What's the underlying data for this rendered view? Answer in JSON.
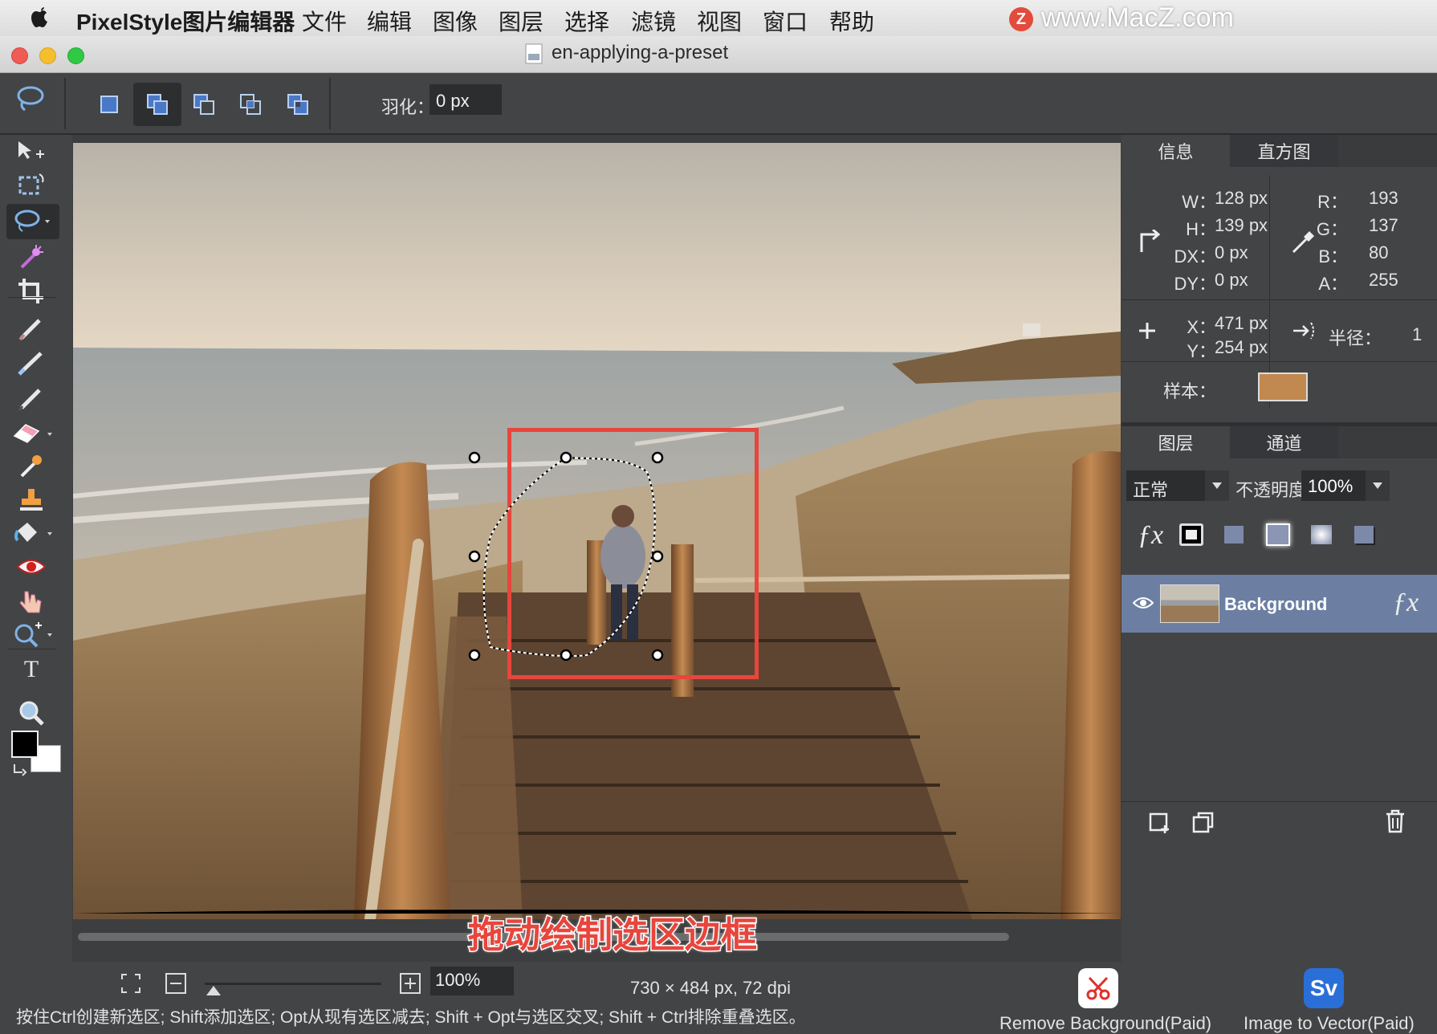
{
  "menubar": {
    "app_name": "PixelStyle图片编辑器",
    "items": [
      "文件",
      "编辑",
      "图像",
      "图层",
      "选择",
      "滤镜",
      "视图",
      "窗口",
      "帮助"
    ],
    "watermark": "www.MacZ.com"
  },
  "window": {
    "title": "en-applying-a-preset"
  },
  "options": {
    "feather_label": "羽化：",
    "feather_value": "0 px"
  },
  "info_panel": {
    "tabs": [
      "信息",
      "直方图"
    ],
    "w_label": "W：",
    "w_value": "128 px",
    "h_label": "H：",
    "h_value": "139 px",
    "dx_label": "DX：",
    "dx_value": "0 px",
    "dy_label": "DY：",
    "dy_value": "0 px",
    "r_label": "R：",
    "r_value": "193",
    "g_label": "G：",
    "g_value": "137",
    "b_label": "B：",
    "b_value": "80",
    "a_label": "A：",
    "a_value": "255",
    "x_label": "X：",
    "x_value": "471 px",
    "y_label": "Y：",
    "y_value": "254 px",
    "radius_label": "半径：",
    "radius_value": "1",
    "sample_label": "样本：",
    "sample_color": "#c18950"
  },
  "layers_panel": {
    "tabs": [
      "图层",
      "通道"
    ],
    "blend_mode": "正常",
    "opacity_label": "不透明度",
    "opacity_value": "100%",
    "layer_name": "Background"
  },
  "canvas": {
    "annotation": "拖动绘制选区边框"
  },
  "status": {
    "zoom": "100%",
    "image_info": "730 × 484 px, 72 dpi",
    "hint": "按住Ctrl创建新选区; Shift添加选区; Opt从现有选区减去; Shift + Opt与选区交叉; Shift + Ctrl排除重叠选区。",
    "remove_bg": "Remove Background(Paid)",
    "img_to_vector": "Image to Vector(Paid)"
  },
  "colors": {
    "accent_select": "#6c7fa3",
    "annotation_red": "#e8453c"
  }
}
